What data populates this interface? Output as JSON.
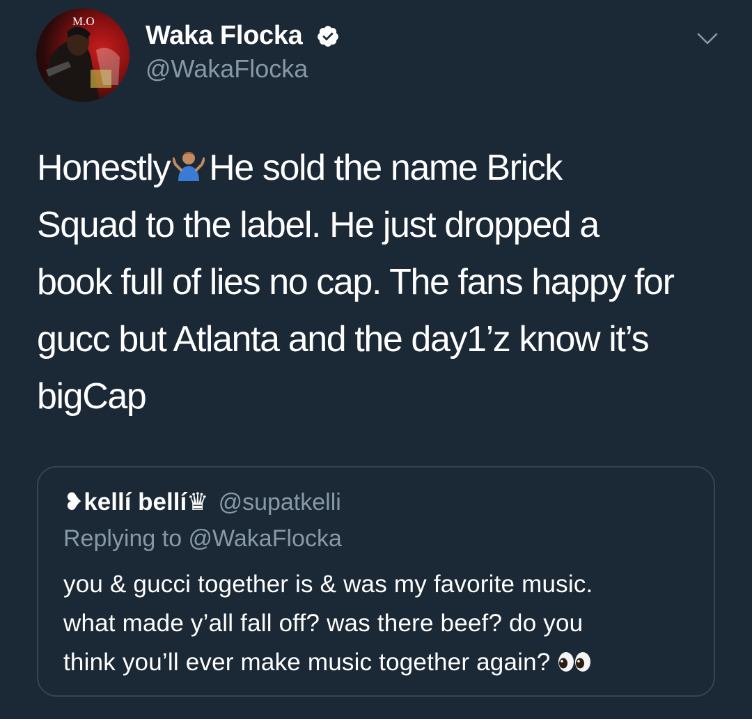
{
  "author": {
    "display_name": "Waka Flocka",
    "handle": "@WakaFlocka",
    "avatar_text": "M.O"
  },
  "tweet": {
    "text_lines": [
      "Honestly",
      "He sold the name Brick",
      "Squad to the label. He just dropped a",
      "book full of lies no cap. The fans happy for",
      "gucc but Atlanta and the day1’z know it’s",
      "bigCap"
    ]
  },
  "quoted_tweet": {
    "display_name": "❥kellí bellí♛",
    "handle": "@supatkelli",
    "replying_to": "Replying to @WakaFlocka",
    "text_lines": [
      "you & gucci together is & was my favorite music.",
      "what made y’all fall off? was there beef? do you",
      "think you’ll ever make music together again?"
    ]
  },
  "icons": {
    "verified": "verified-badge-icon",
    "more": "chevron-down-icon",
    "shrug": "person-shrugging-emoji",
    "eyes": "eyes-emoji"
  },
  "colors": {
    "background": "#1b2836",
    "secondary_text": "#8899a6",
    "border": "#38444d"
  }
}
